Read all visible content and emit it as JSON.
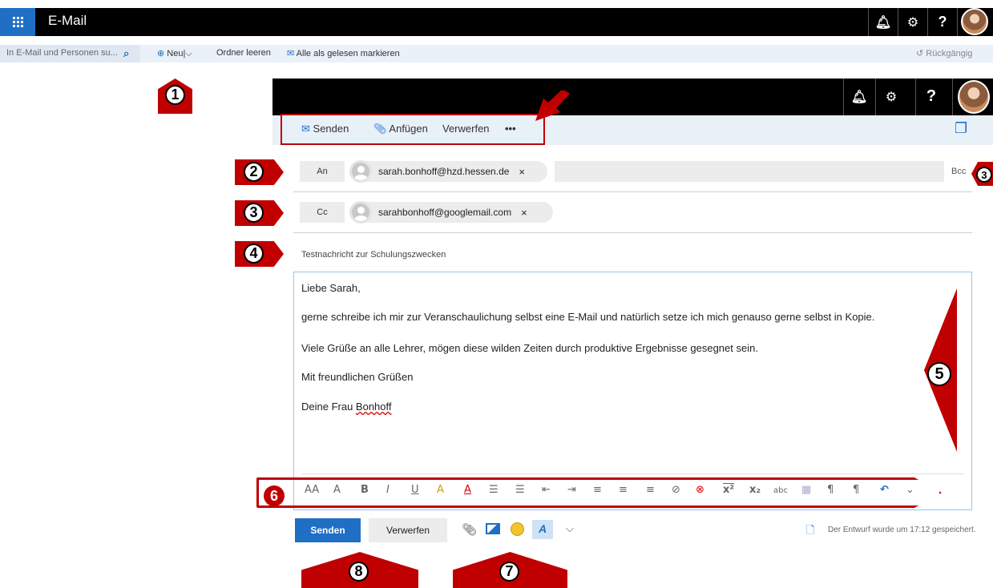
{
  "app": {
    "title": "E-Mail"
  },
  "command_bar": {
    "search_placeholder": "In E-Mail und Personen su...",
    "new_label": "Neu",
    "new_separator": "|",
    "empty_folder": "Ordner leeren",
    "mark_all_read": "Alle als gelesen markieren",
    "undo": "Rückgängig"
  },
  "compose": {
    "toolbar": {
      "send": "Senden",
      "attach": "Anfügen",
      "discard": "Verwerfen",
      "more": "•••"
    },
    "to": {
      "label": "An",
      "recipient": "sarah.bonhoff@hzd.hessen.de",
      "remove": "×"
    },
    "cc": {
      "label": "Cc",
      "recipient": "sarahbonhoff@googlemail.com",
      "remove": "×"
    },
    "bcc_label": "Bcc",
    "subject": "Testnachricht zur Schulungszwecken",
    "body": {
      "line1": "Liebe Sarah,",
      "line2": "gerne schreibe ich mir zur Veranschaulichung selbst eine E-Mail und natürlich setze ich mich genauso gerne selbst in Kopie.",
      "line3": "Viele Grüße an alle Lehrer, mögen diese wilden Zeiten durch produktive Ergebnisse gesegnet  sein.",
      "line4": "Mit freundlichen Grüßen",
      "line5a": "Deine Frau ",
      "line5b": "Bonhoff"
    },
    "format_toolbar": [
      "AA",
      "A",
      "B",
      "I",
      "U",
      "A",
      "A",
      "☰",
      "☰",
      "⇤",
      "⇥",
      "≡",
      "≡",
      "≡",
      "⊘",
      "⊗",
      "x²",
      "x₂",
      "abc",
      "▦",
      "¶",
      "¶",
      "↶",
      "⌄"
    ],
    "footer": {
      "send": "Senden",
      "discard": "Verwerfen",
      "draft_status": "Der Entwurf wurde um 17:12 gespeichert."
    }
  },
  "markers": {
    "m1": "1",
    "m2": "2",
    "m3a": "3",
    "m3b": "3",
    "m4": "4",
    "m5": "5",
    "m6": "6",
    "m7": "7",
    "m8": "8"
  },
  "colors": {
    "accent": "#1f6fc5",
    "marker": "#c00000",
    "topbar": "#000000"
  },
  "icons": [
    "waffle-icon",
    "bell-icon",
    "gear-icon",
    "help-icon",
    "search-icon",
    "plus-circle-icon",
    "chevron-down-icon",
    "envelope-open-icon",
    "undo-icon",
    "send-icon",
    "paperclip-icon",
    "popout-icon",
    "person-icon",
    "image-icon",
    "emoji-icon",
    "format-icon",
    "draft-icon",
    "arrow-icon"
  ]
}
